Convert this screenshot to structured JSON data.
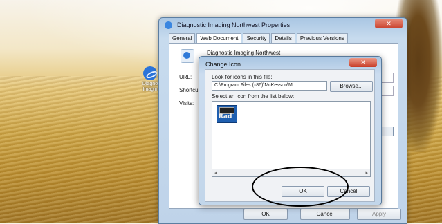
{
  "desktop": {
    "shortcut_label_line1": "Diagno",
    "shortcut_label_line2": "Imagin"
  },
  "properties_window": {
    "title": "Diagnostic Imaging Northwest Properties",
    "tabs": [
      "General",
      "Web Document",
      "Security",
      "Details",
      "Previous Versions"
    ],
    "active_tab": "Web Document",
    "item_name": "Diagnostic Imaging Northwest",
    "labels": {
      "url": "URL:",
      "shortcut": "Shortcu",
      "visits": "Visits:"
    },
    "buttons": {
      "ok": "OK",
      "cancel": "Cancel",
      "apply": "Apply"
    },
    "close_glyph": "✕"
  },
  "change_icon_dialog": {
    "title": "Change Icon",
    "look_for_label": "Look for icons in this file:",
    "file_path": "C:\\Program Files (x86)\\McKesson\\M",
    "browse_label": "Browse...",
    "select_label": "Select an icon from the list below:",
    "icon_text": "Rad",
    "ok_label": "OK",
    "cancel_label": "Cancel",
    "close_glyph": "✕",
    "scroll_left": "◂",
    "scroll_right": "▸"
  },
  "colors": {
    "selected_icon_bg": "#1f5fb0",
    "close_button": "#c9412d",
    "annotation_ring": "#000000"
  }
}
